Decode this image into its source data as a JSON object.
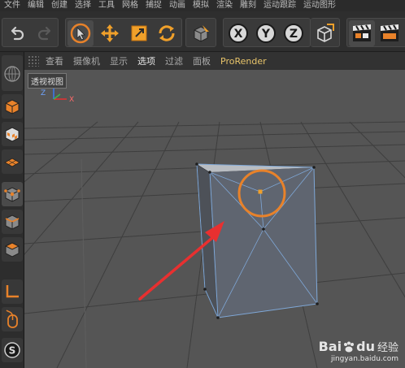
{
  "menu": {
    "items": [
      "文件",
      "编辑",
      "创建",
      "选择",
      "工具",
      "网格",
      "捕捉",
      "动画",
      "模拟",
      "渲染",
      "雕刻",
      "运动跟踪",
      "运动图形"
    ]
  },
  "toolbar": {
    "undo_icon": "undo-icon",
    "redo_icon": "redo-icon",
    "tools": [
      "live-selection-icon",
      "move-icon",
      "scale-icon",
      "rotate-icon",
      "recent-tool-icon"
    ],
    "axes": [
      "X",
      "Y",
      "Z"
    ],
    "coord_icon": "world-coordinate-icon",
    "render_icons": [
      "render-view-icon",
      "render-picture-viewer-icon"
    ]
  },
  "viewport_menu": {
    "items": [
      "查看",
      "摄像机",
      "显示",
      "选项",
      "过滤",
      "面板",
      "ProRender"
    ]
  },
  "viewport": {
    "label": "透视视图",
    "axis_labels": {
      "y": "Z",
      "x": "X"
    },
    "watermark_brand": "Bai",
    "watermark_du": "du",
    "watermark_jy": "经验",
    "watermark_url": "jingyan.baidu.com"
  },
  "palette": {
    "icons": [
      "model-mode-icon",
      "texture-mode-icon",
      "workplane-icon",
      "points-mode-icon",
      "edges-mode-icon",
      "polygons-mode-icon",
      "axis-mode-icon",
      "mouse-icon",
      "snap-icon"
    ]
  },
  "colors": {
    "accent_orange": "#e8822a",
    "annotation_red": "#e83030",
    "axis_blue": "#3a7af0"
  }
}
